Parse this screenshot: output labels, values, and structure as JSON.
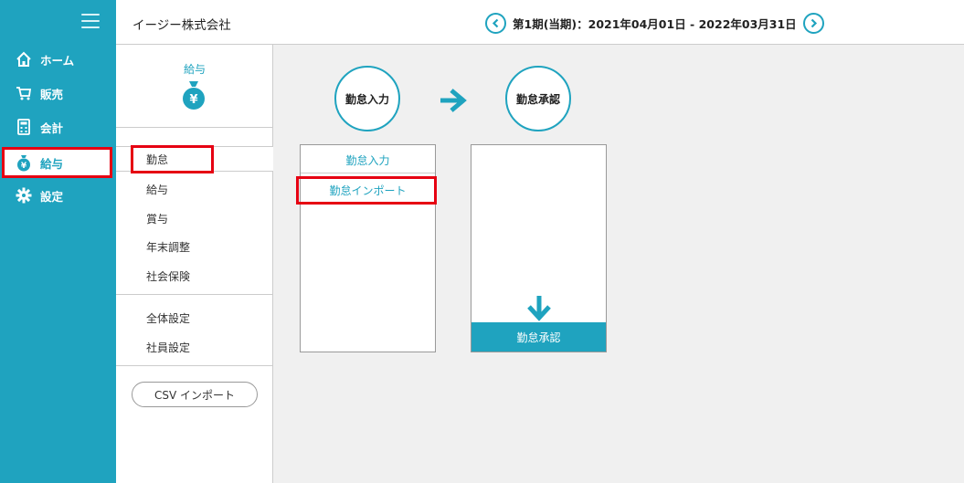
{
  "sidebar": {
    "items": [
      {
        "label": "ホーム",
        "icon": "home-icon"
      },
      {
        "label": "販売",
        "icon": "cart-icon"
      },
      {
        "label": "会計",
        "icon": "calculator-icon"
      },
      {
        "label": "給与",
        "icon": "money-bag-icon"
      },
      {
        "label": "設定",
        "icon": "gear-icon"
      }
    ],
    "active_index": 3
  },
  "header": {
    "company": "イージー株式会社",
    "period": "第1期(当期)：2021年04月01日 - 2022年03月31日"
  },
  "submenu": {
    "title": "給与",
    "bag_symbol": "¥",
    "group1": [
      "勤怠",
      "給与",
      "賞与",
      "年末調整",
      "社会保険"
    ],
    "group2": [
      "全体設定",
      "社員設定"
    ],
    "active": "勤怠",
    "csv_button": "CSV インポート"
  },
  "workflow": {
    "step1": "勤怠入力",
    "step2": "勤怠承認",
    "panel1_links": [
      "勤怠入力",
      "勤怠インポート"
    ],
    "panel2_button": "勤怠承認"
  },
  "colors": {
    "accent": "#1fa3bf",
    "highlight": "#e60012"
  }
}
